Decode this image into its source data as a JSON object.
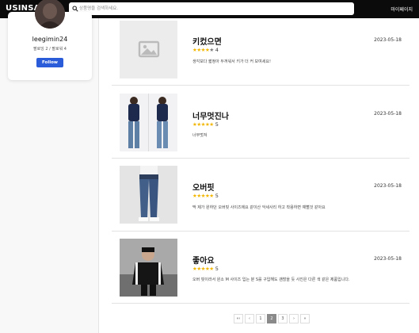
{
  "header": {
    "logo": "USINSA",
    "search_placeholder": "상품명을 검색하세요.",
    "mypage_label": "마이페이지"
  },
  "profile": {
    "username": "leegimin24",
    "follow_stats": "팔로잉 2 / 팔로워 4",
    "follow_button": "Follow"
  },
  "reviews": [
    {
      "title": "키컸으면",
      "stars": "★★★★",
      "star_off": "★",
      "rating": "4",
      "date": "2023-05-18",
      "text": "생각보다 짧정아 두꺼워서 키가 더 커 보여세요!"
    },
    {
      "title": "너무멋진나",
      "stars": "★★★★★",
      "star_off": "",
      "rating": "5",
      "date": "2023-05-18",
      "text": "너무멋져"
    },
    {
      "title": "오버핏",
      "stars": "★★★★★",
      "star_off": "",
      "rating": "5",
      "date": "2023-05-18",
      "text": "딱 제가 원하던 오버핏 사이즈에요 같이산 악세사리 하고 착용하면 예뻘것 같아요"
    },
    {
      "title": "좋아요",
      "stars": "★★★★★",
      "star_off": "",
      "rating": "5",
      "date": "2023-05-18",
      "text": "오버 핏이라서 원소 M 사이즈 입는 분 S를 구입해도 괜찮을 듯 사진은 다른 색 같은 제품입니다."
    }
  ],
  "pagination": {
    "first": "«‹",
    "prev": "‹",
    "pages": [
      "1",
      "2",
      "3"
    ],
    "current": "2",
    "next": "›",
    "last": "»"
  },
  "colors": {
    "topbar": "#0b0b0b",
    "follow_button": "#2a5bd8",
    "star": "#f2b600"
  }
}
